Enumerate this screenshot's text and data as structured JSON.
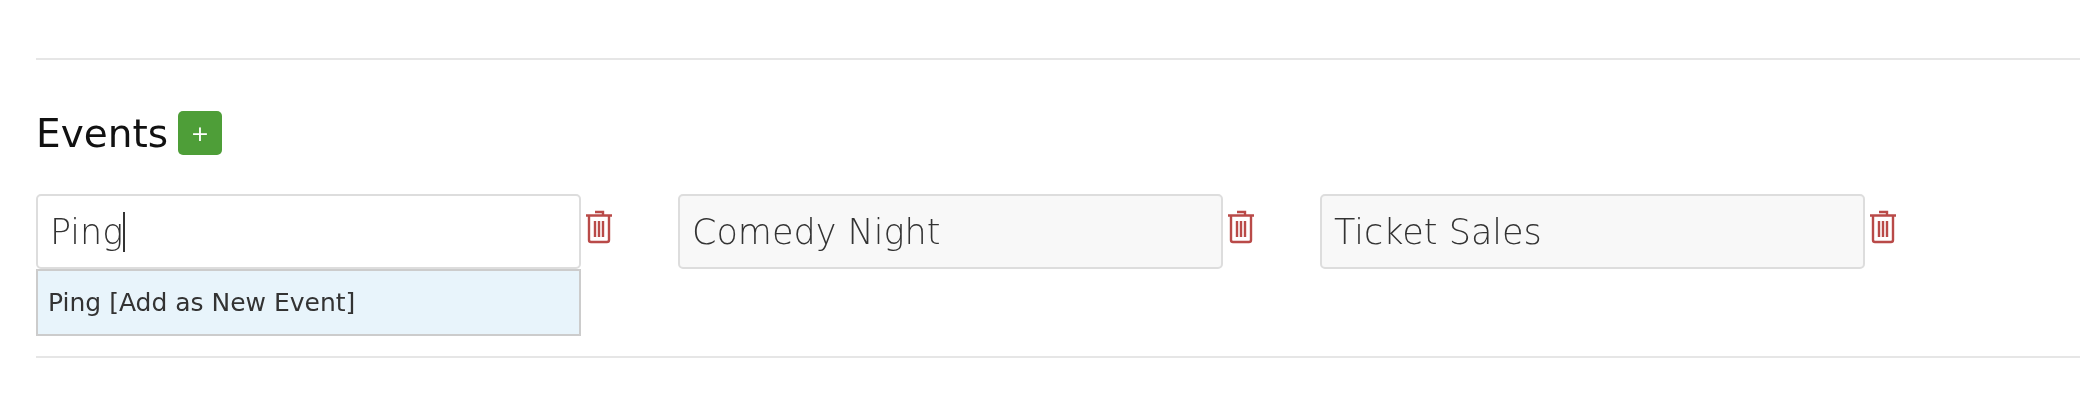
{
  "section": {
    "title": "Events",
    "add_button": "+"
  },
  "events": [
    {
      "value": "Ping",
      "focused": true,
      "suggestions": [
        "Ping [Add as New Event]"
      ]
    },
    {
      "value": "Comedy Night",
      "focused": false
    },
    {
      "value": "Ticket Sales",
      "focused": false
    }
  ]
}
